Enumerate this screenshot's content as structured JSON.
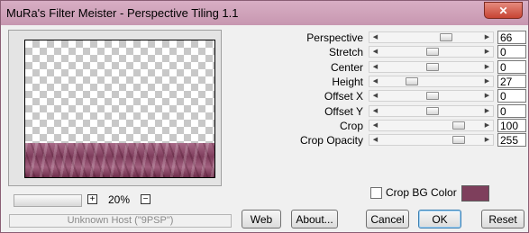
{
  "window": {
    "title": "MuRa's Filter Meister - Perspective Tiling 1.1",
    "close_glyph": "✕"
  },
  "preview": {
    "zoom_minus_glyph": "−",
    "zoom_plus_glyph": "+",
    "zoom_level": "20%",
    "status_text": "Unknown Host (\"9PSP\")"
  },
  "params": [
    {
      "label": "Perspective",
      "value": "66",
      "fraction": 0.66
    },
    {
      "label": "Stretch",
      "value": "0",
      "fraction": 0.5
    },
    {
      "label": "Center",
      "value": "0",
      "fraction": 0.5
    },
    {
      "label": "Height",
      "value": "27",
      "fraction": 0.27
    },
    {
      "label": "Offset X",
      "value": "0",
      "fraction": 0.5
    },
    {
      "label": "Offset Y",
      "value": "0",
      "fraction": 0.5
    },
    {
      "label": "Crop",
      "value": "100",
      "fraction": 0.8
    },
    {
      "label": "Crop Opacity",
      "value": "255",
      "fraction": 0.8
    }
  ],
  "crop_bg": {
    "label": "Crop BG Color",
    "checked": false,
    "color": "#7e3f5c"
  },
  "buttons": {
    "web": "Web",
    "about": "About...",
    "cancel": "Cancel",
    "ok": "OK",
    "reset": "Reset"
  },
  "icons": {
    "arrow_left": "◀",
    "arrow_right": "▶"
  }
}
